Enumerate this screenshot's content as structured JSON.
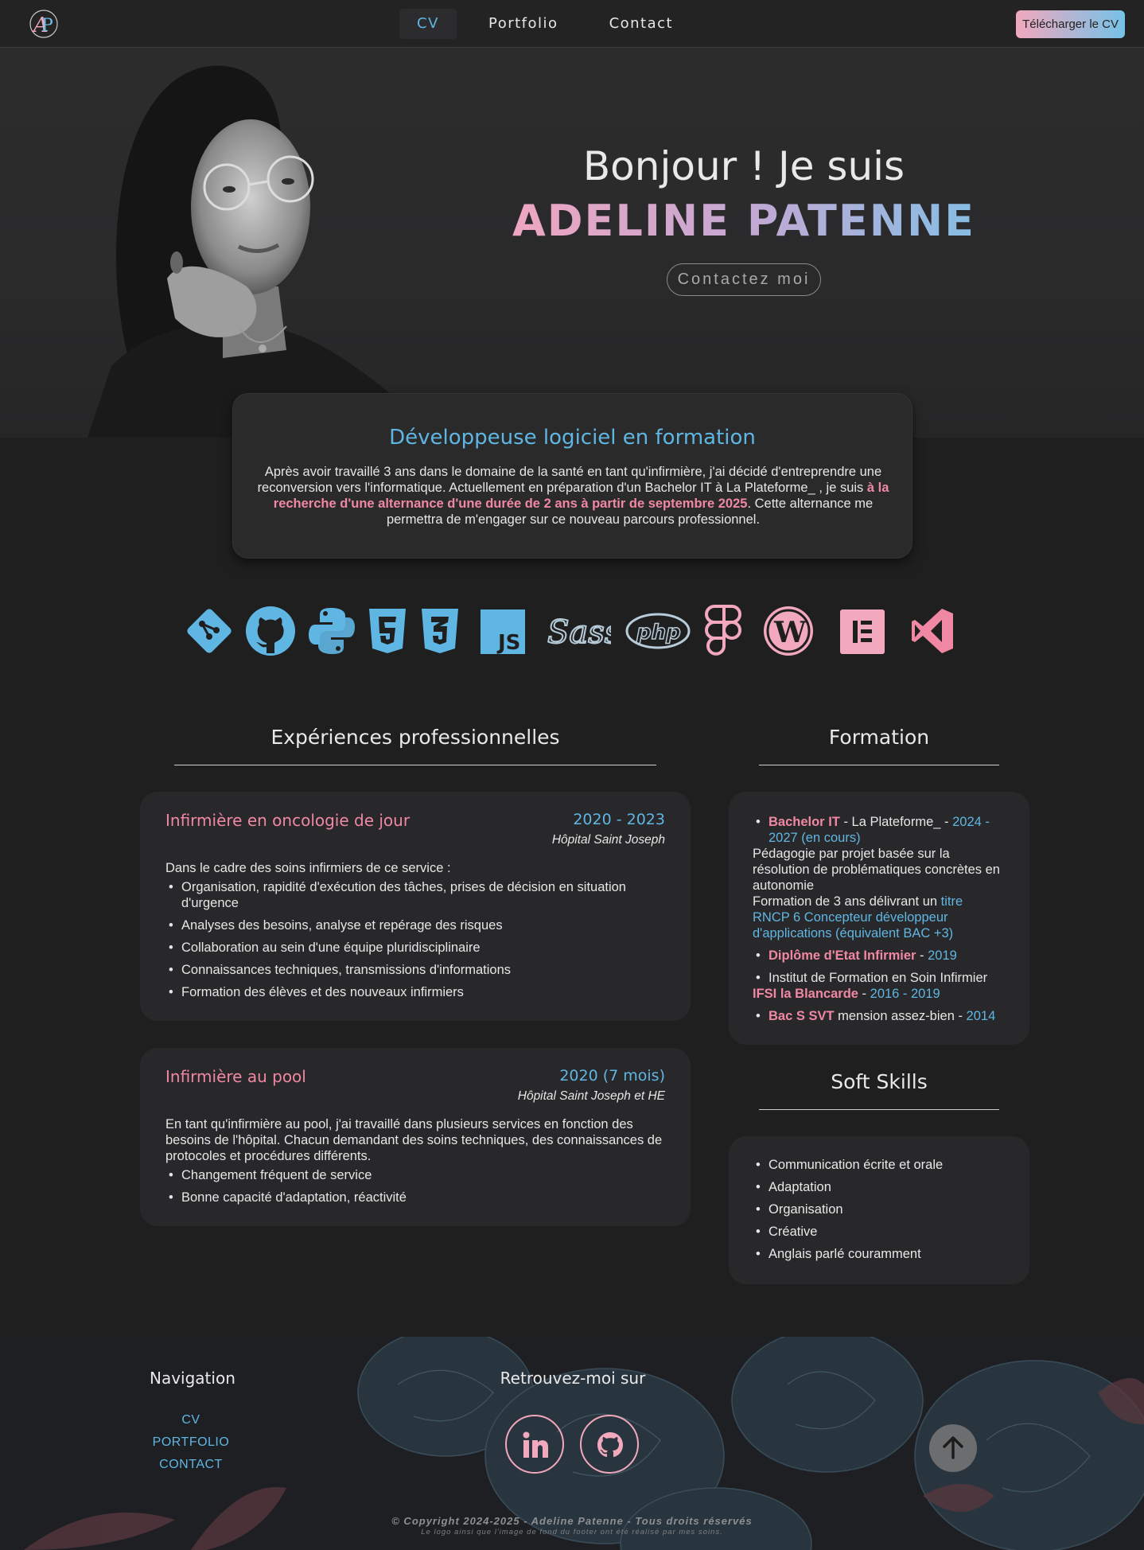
{
  "header": {
    "logo_letters": "AP",
    "nav": [
      {
        "label": "CV"
      },
      {
        "label": "Portfolio"
      },
      {
        "label": "Contact"
      }
    ],
    "download_label": "Télécharger le CV"
  },
  "hero": {
    "greeting": "Bonjour ! Je suis",
    "name": "ADELINE PATENNE",
    "contact_button": "Contactez moi"
  },
  "intro": {
    "title": "Développeuse logiciel en formation",
    "text_before": "Après avoir travaillé 3 ans dans le domaine de la santé en tant qu'infirmière, j'ai décidé d'entreprendre une reconversion vers l'informatique. Actuellement en préparation d'un Bachelor IT à La Plateforme_ , je suis ",
    "text_highlight": "à la recherche d'une alternance d'une durée de 2 ans à partir de septembre 2025",
    "text_after": ". Cette alternance me permettra de m'engager sur ce nouveau parcours professionnel."
  },
  "tech_icons": [
    "git-icon",
    "github-icon",
    "python-icon",
    "html5-icon",
    "css3-icon",
    "javascript-icon",
    "sass-icon",
    "php-icon",
    "figma-icon",
    "wordpress-icon",
    "elementor-icon",
    "vscode-icon"
  ],
  "tech_labels": {
    "js": "JS",
    "sass": "Sass",
    "php": "php"
  },
  "experiences": {
    "title": "Expériences professionnelles",
    "jobs": [
      {
        "title": "Infirmière en oncologie de jour",
        "date": "2020 - 2023",
        "place": "Hôpital Saint Joseph",
        "intro": "Dans le cadre des soins infirmiers de ce service :",
        "items": [
          "Organisation, rapidité d'exécution des tâches, prises de décision en situation d'urgence",
          "Analyses des besoins, analyse et repérage des risques",
          "Collaboration au sein d'une équipe pluridisciplinaire",
          "Connaissances techniques, transmissions d'informations",
          "Formation des élèves et des nouveaux infirmiers"
        ]
      },
      {
        "title": "Infirmière au pool",
        "date": "2020 (7 mois)",
        "place": "Hôpital Saint Joseph et HE",
        "intro": "En tant qu'infirmière au pool, j'ai travaillé dans plusieurs services en fonction des besoins de l'hôpital. Chacun demandant des soins techniques, des connaissances de protocoles et procédures différents.",
        "items": [
          "Changement fréquent de service",
          "Bonne capacité d'adaptation, réactivité"
        ]
      }
    ]
  },
  "formation": {
    "title": "Formation",
    "bachelor": {
      "name": "Bachelor IT",
      "school": " - La Plateforme_ - ",
      "dates": "2024 - 2027 (en cours)",
      "desc": "Pédagogie par projet basée sur la résolution de problématiques concrètes en autonomie",
      "desc2": "Formation de 3 ans délivrant un ",
      "rncp": "titre RNCP 6 Concepteur développeur d'applications (équivalent BAC +3)"
    },
    "diplome": {
      "name": "Diplôme d'Etat Infirmier",
      "sep": " - ",
      "year": "2019"
    },
    "ifsi": {
      "line": "Institut de Formation en Soin Infirmier",
      "name": "IFSI la Blancarde",
      "sep": " - ",
      "years": "2016 - 2019"
    },
    "bac": {
      "name": "Bac S SVT",
      "mention": " mension assez-bien - ",
      "year": "2014"
    }
  },
  "soft_skills": {
    "title": "Soft Skills",
    "items": [
      "Communication écrite et orale",
      "Adaptation",
      "Organisation",
      "Créative",
      "Anglais parlé couramment"
    ]
  },
  "footer": {
    "nav_title": "Navigation",
    "links": [
      "CV",
      "PORTFOLIO",
      "CONTACT"
    ],
    "social_title": "Retrouvez-moi sur",
    "social": [
      "linkedin-icon",
      "github-icon"
    ],
    "copyright": "© Copyright 2024-2025 - Adeline Patenne - Tous droits réservés",
    "credit": "Le logo ainsi que l'image de fond du footer ont été réalisé par mes soins."
  },
  "colors": {
    "pink": "#f088a3",
    "blue": "#5fb6e3",
    "bg": "#1f1f20",
    "card": "#28282a"
  }
}
